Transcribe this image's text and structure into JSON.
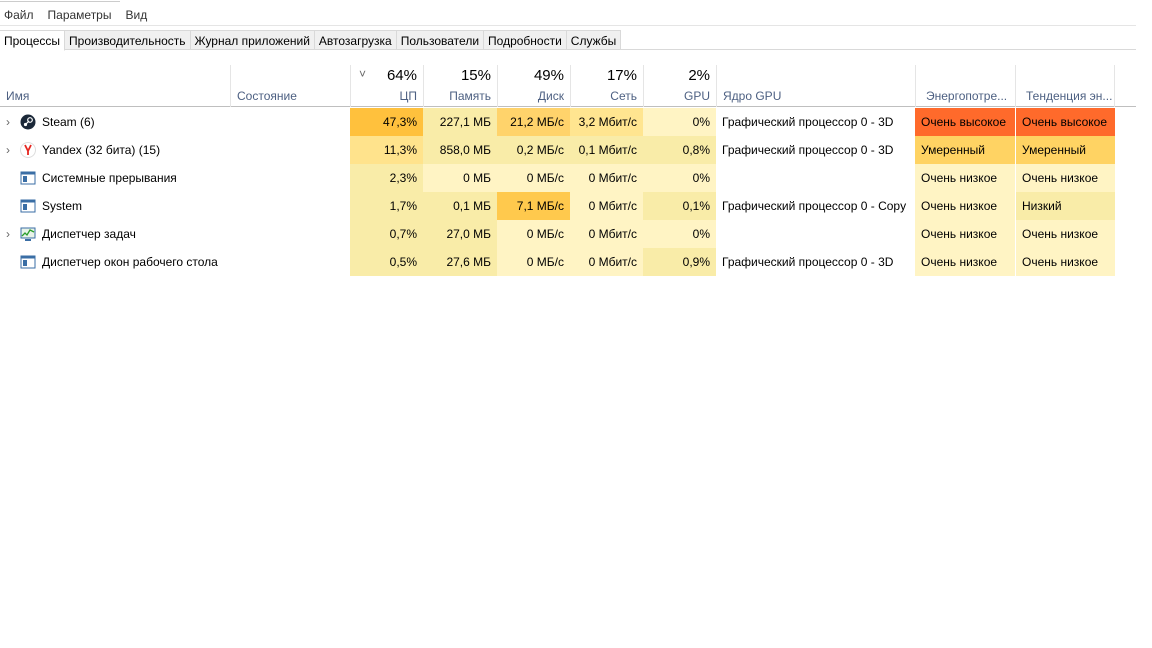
{
  "menu": [
    "Файл",
    "Параметры",
    "Вид"
  ],
  "tabs": [
    "Процессы",
    "Производительность",
    "Журнал приложений",
    "Автозагрузка",
    "Пользователи",
    "Подробности",
    "Службы"
  ],
  "columns": {
    "name": "Имя",
    "state": "Состояние",
    "cpu": {
      "pct": "64%",
      "label": "ЦП"
    },
    "mem": {
      "pct": "15%",
      "label": "Память"
    },
    "disk": {
      "pct": "49%",
      "label": "Диск"
    },
    "net": {
      "pct": "17%",
      "label": "Сеть"
    },
    "gpu": {
      "pct": "2%",
      "label": "GPU"
    },
    "gpucore": "Ядро GPU",
    "power": "Энергопотре...",
    "trend": "Тенденция эн..."
  },
  "rows": [
    {
      "name": "Steam (6)",
      "icon": "steam-icon",
      "expand": true,
      "cpu": "47,3%",
      "mem": "227,1 МБ",
      "disk": "21,2 МБ/с",
      "net": "3,2 Мбит/с",
      "gpu": "0%",
      "gpucore": "Графический процессор 0 - 3D",
      "power": "Очень высокое",
      "trend": "Очень высокое",
      "colors": [
        "#ffc13d",
        "#f9eca8",
        "#ffd36b",
        "#ffe590",
        "#fff4c4",
        "#ff6a2b",
        "#ff6a2b"
      ]
    },
    {
      "name": "Yandex (32 бита) (15)",
      "icon": "yandex-icon",
      "expand": true,
      "cpu": "11,3%",
      "mem": "858,0 МБ",
      "disk": "0,2 МБ/с",
      "net": "0,1 Мбит/с",
      "gpu": "0,8%",
      "gpucore": "Графический процессор 0 - 3D",
      "power": "Умеренный",
      "trend": "Умеренный",
      "colors": [
        "#ffe38c",
        "#f9eca8",
        "#f9eca8",
        "#f9eca8",
        "#f9eca8",
        "#ffd363",
        "#ffd363"
      ]
    },
    {
      "name": "Системные прерывания",
      "icon": "window-icon",
      "expand": false,
      "cpu": "2,3%",
      "mem": "0 МБ",
      "disk": "0 МБ/с",
      "net": "0 Мбит/с",
      "gpu": "0%",
      "gpucore": "",
      "power": "Очень низкое",
      "trend": "Очень низкое",
      "colors": [
        "#f9eca8",
        "#fff4c4",
        "#fff4c4",
        "#fff4c4",
        "#fff4c4",
        "#fff4c4",
        "#fff4c4"
      ]
    },
    {
      "name": "System",
      "icon": "window-icon",
      "expand": false,
      "cpu": "1,7%",
      "mem": "0,1 МБ",
      "disk": "7,1 МБ/с",
      "net": "0 Мбит/с",
      "gpu": "0,1%",
      "gpucore": "Графический процессор 0 - Copy",
      "power": "Очень низкое",
      "trend": "Низкий",
      "colors": [
        "#f9eca8",
        "#f9eca8",
        "#ffc94d",
        "#fff4c4",
        "#f9eca8",
        "#fff4c4",
        "#f9eca8"
      ]
    },
    {
      "name": "Диспетчер задач",
      "icon": "task-manager-icon",
      "expand": true,
      "cpu": "0,7%",
      "mem": "27,0 МБ",
      "disk": "0 МБ/с",
      "net": "0 Мбит/с",
      "gpu": "0%",
      "gpucore": "",
      "power": "Очень низкое",
      "trend": "Очень низкое",
      "colors": [
        "#f9eca8",
        "#f9eca8",
        "#fff4c4",
        "#fff4c4",
        "#fff4c4",
        "#fff4c4",
        "#fff4c4"
      ]
    },
    {
      "name": "Диспетчер окон рабочего стола",
      "icon": "window-icon",
      "expand": false,
      "cpu": "0,5%",
      "mem": "27,6 МБ",
      "disk": "0 МБ/с",
      "net": "0 Мбит/с",
      "gpu": "0,9%",
      "gpucore": "Графический процессор 0 - 3D",
      "power": "Очень низкое",
      "trend": "Очень низкое",
      "colors": [
        "#f9eca8",
        "#f9eca8",
        "#fff4c4",
        "#fff4c4",
        "#f9eca8",
        "#fff4c4",
        "#fff4c4"
      ]
    }
  ]
}
